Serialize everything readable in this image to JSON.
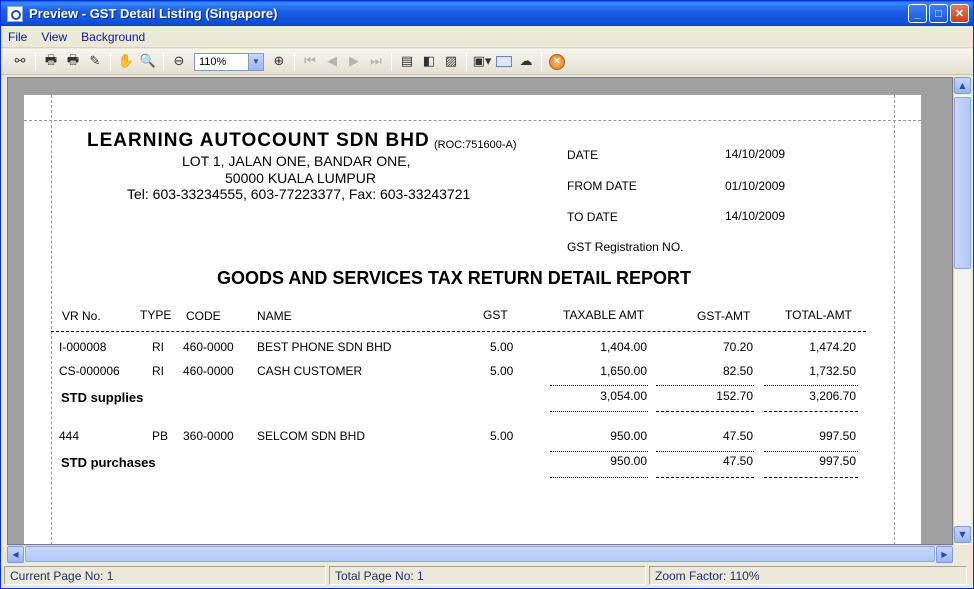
{
  "window": {
    "title": "Preview - GST Detail Listing (Singapore)"
  },
  "menu": {
    "items": [
      "File",
      "View",
      "Background"
    ]
  },
  "toolbar": {
    "zoom_value": "110%"
  },
  "report": {
    "company": "LEARNING  AUTOCOUNT  SDN  BHD",
    "roc": "(ROC:751600-A)",
    "address1": "LOT 1, JALAN ONE,  BANDAR  ONE,",
    "address2": "50000 KUALA  LUMPUR",
    "contact": "Tel: 603-33234555, 603-77223377, Fax: 603-33243721",
    "meta": {
      "date_label": "DATE",
      "date_value": "14/10/2009",
      "from_label": "FROM DATE",
      "from_value": "01/10/2009",
      "to_label": "TO DATE",
      "to_value": "14/10/2009",
      "gst_reg_label": "GST Registration NO."
    },
    "title": "GOODS AND SERVICES TAX RETURN DETAIL REPORT",
    "columns": [
      "VR No.",
      "TYPE",
      "CODE",
      "NAME",
      "GST",
      "TAXABLE AMT",
      "GST-AMT",
      "TOTAL-AMT"
    ],
    "rows": [
      [
        "I-000008",
        "RI",
        "460-0000",
        "BEST PHONE SDN BHD",
        "5.00",
        "1,404.00",
        "70.20",
        "1,474.20"
      ],
      [
        "CS-000006",
        "RI",
        "460-0000",
        "CASH CUSTOMER",
        "5.00",
        "1,650.00",
        "82.50",
        "1,732.50"
      ],
      [
        "444",
        "PB",
        "360-0000",
        "SELCOM SDN BHD",
        "5.00",
        "950.00",
        "47.50",
        "997.50"
      ]
    ],
    "subtotals": [
      {
        "label": "STD supplies",
        "taxable": "3,054.00",
        "gst": "152.70",
        "total": "3,206.70"
      },
      {
        "label": "STD purchases",
        "taxable": "950.00",
        "gst": "47.50",
        "total": "997.50"
      }
    ]
  },
  "status": {
    "current_page": "Current Page No: 1",
    "total_page": "Total Page No: 1",
    "zoom": "Zoom Factor: 110%"
  }
}
